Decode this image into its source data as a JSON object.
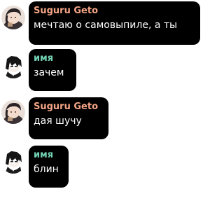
{
  "colors": {
    "bubble_bg": "#000000",
    "text": "#ffffff",
    "geto_name": "#f4a585",
    "imya_name": "#72d2b3"
  },
  "messages": [
    {
      "sender": "Suguru Geto",
      "text": "мечтаю о самовыпиле, а ты",
      "avatar": "geto-avatar-icon"
    },
    {
      "sender": "имя",
      "text": "зачем",
      "avatar": "imya-avatar-icon"
    },
    {
      "sender": "Suguru Geto",
      "text": "дая шучу",
      "avatar": "geto-avatar-icon"
    },
    {
      "sender": "имя",
      "text": "блин",
      "avatar": "imya-avatar-icon"
    }
  ]
}
